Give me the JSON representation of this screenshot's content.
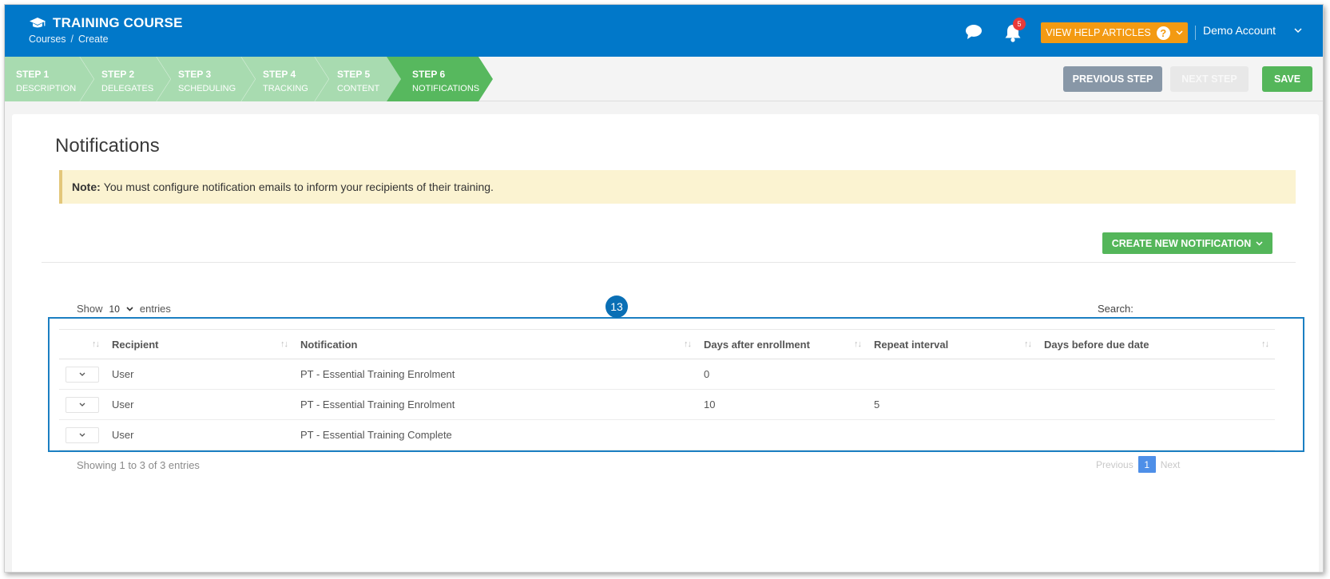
{
  "header": {
    "title": "TRAINING COURSE",
    "breadcrumbs": [
      "Courses",
      "/",
      "Create"
    ],
    "notification_count": "5",
    "help_label": "VIEW HELP ARTICLES",
    "help_glyph": "?",
    "account_name": "Demo Account",
    "colors": {
      "bar": "#0178c9",
      "help": "#f39a12",
      "badge": "#e83a3a"
    }
  },
  "steps": [
    {
      "number": "STEP 1",
      "label": "DESCRIPTION",
      "state": "done"
    },
    {
      "number": "STEP 2",
      "label": "DELEGATES",
      "state": "done"
    },
    {
      "number": "STEP 3",
      "label": "SCHEDULING",
      "state": "done"
    },
    {
      "number": "STEP 4",
      "label": "TRACKING",
      "state": "done"
    },
    {
      "number": "STEP 5",
      "label": "CONTENT",
      "state": "done"
    },
    {
      "number": "STEP 6",
      "label": "NOTIFICATIONS",
      "state": "active"
    }
  ],
  "actions": {
    "previous": "PREVIOUS STEP",
    "next": "NEXT STEP",
    "save": "SAVE"
  },
  "main": {
    "title": "Notifications",
    "note_label": "Note:",
    "note_text": "You must configure notification emails to inform your recipients of their training.",
    "create_label": "CREATE NEW NOTIFICATION",
    "show_label": "Show",
    "show_value": "10",
    "entries_label": "entries",
    "search_label": "Search:",
    "marker": "13"
  },
  "table": {
    "columns": [
      "Recipient",
      "Notification",
      "Days after enrollment",
      "Repeat interval",
      "Days before due date"
    ],
    "rows": [
      {
        "recipient": "User",
        "notification": "PT - Essential Training Enrolment",
        "days_after": "0",
        "repeat": "",
        "before_due": ""
      },
      {
        "recipient": "User",
        "notification": "PT - Essential Training Enrolment",
        "days_after": "10",
        "repeat": "5",
        "before_due": ""
      },
      {
        "recipient": "User",
        "notification": "PT - Essential Training Complete",
        "days_after": "",
        "repeat": "",
        "before_due": ""
      }
    ],
    "info": "Showing 1 to 3 of 3 entries",
    "pager": {
      "previous": "Previous",
      "current": "1",
      "next": "Next"
    }
  }
}
